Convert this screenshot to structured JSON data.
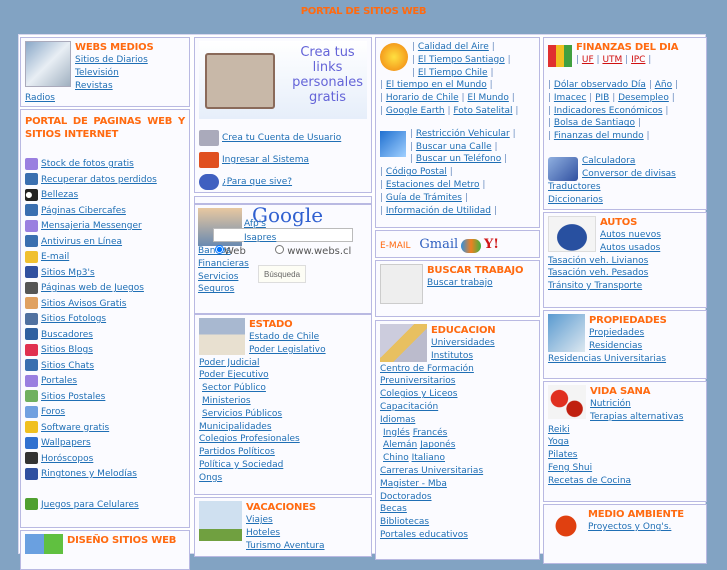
{
  "title": "PORTAL DE SITIOS WEB",
  "medios": {
    "heading": "WEBS MEDIOS",
    "links": [
      "Sitios de Diarios",
      "Televisión",
      "Revistas",
      "Radios"
    ]
  },
  "portal": {
    "heading": "PORTAL DE PAGINAS WEB Y SITIOS INTERNET",
    "links": [
      "Stock de fotos gratis",
      "Recuperar datos perdidos",
      "Bellezas",
      "Páginas Cibercafes",
      "Mensajeria Messenger",
      "Antivirus en Línea",
      "E-mail",
      "Sitios Mp3's",
      "Páginas web de Juegos",
      "Sitios Avisos Gratis",
      "Sitios Fotologs",
      "Buscadores",
      "Sitios Blogs",
      "Sitios Chats",
      "Portales",
      "Sitios Postales",
      "Foros",
      "Software gratis",
      "Wallpapers",
      "Horóscopos",
      "Ringtones y Melodías",
      "Juegos para Celulares"
    ],
    "icons": [
      "folder-icon",
      "monitor-icon",
      "eyes-icon",
      "monitor-icon",
      "folder-icon",
      "monitor-icon",
      "envelope-icon",
      "music-note-icon",
      "gamepad-icon",
      "pencil-icon",
      "photo-icon",
      "magnifier-icon",
      "checkmark-icon",
      "monitor-icon",
      "folder-icon",
      "postcard-icon",
      "speech-bubble-icon",
      "lightbulb-icon",
      "wallpaper-icon",
      "horoscope-icon",
      "music-note-icon",
      "cellphone-icon"
    ],
    "colors": [
      "#9a7fe0",
      "#3a6fb0",
      "#222",
      "#3a6fb0",
      "#9a7fe0",
      "#3a6fb0",
      "#f0c030",
      "#3050a0",
      "#555",
      "#e0a060",
      "#5070a0",
      "#3060a0",
      "#e03050",
      "#3a6fb0",
      "#9a7fe0",
      "#70b060",
      "#70a0e0",
      "#f0c020",
      "#3070d0",
      "#333",
      "#3050a0",
      "#50a030"
    ]
  },
  "diseno": {
    "heading": "DISEÑO SITIOS WEB"
  },
  "crea": {
    "banner": [
      "Crea tus",
      "links",
      "personales",
      "gratis"
    ],
    "links": [
      "Crea tu Cuenta de Usuario",
      "Ingresar al Sistema",
      "¿Para que sive?"
    ]
  },
  "google": {
    "logo": "Google",
    "links": [
      "Afp's",
      "Isapres",
      "Bancos",
      "Financieras",
      "Servicios",
      "Seguros"
    ],
    "radio_web": "Web",
    "radio_site": "www.webs.cl",
    "button": "Búsqueda",
    "input_value": ""
  },
  "estado": {
    "heading": "ESTADO",
    "links": [
      "Estado de Chile",
      "Poder Legislativo",
      "Poder Judicial",
      "Poder Ejecutivo",
      "Sector Público",
      "Ministerios",
      "Servicios Públicos",
      "Municipalidades",
      "Colegios Profesionales",
      "Partidos Políticos",
      "Política y Sociedad",
      "Ongs"
    ]
  },
  "vacaciones": {
    "heading": "VACACIONES",
    "links": [
      "Viajes",
      "Hoteles",
      "Turismo Aventura"
    ]
  },
  "utilidad": {
    "links": [
      "Calidad del Aire",
      "El Tiempo Santiago",
      "El Tiempo Chile",
      "El tiempo en el Mundo",
      "Horario de Chile",
      "El Mundo",
      "Google Earth",
      "Foto Satelital",
      "Restricción Vehicular",
      "Buscar una Calle",
      "Buscar un Teléfono",
      "Código Postal",
      "Estaciones del Metro",
      "Guía de Trámites",
      "Información de Utilidad"
    ]
  },
  "email": {
    "label": "E-MAIL",
    "gmail": "Gmail",
    "yahoo": "Y!"
  },
  "trabajo": {
    "heading": "BUSCAR TRABAJO",
    "links": [
      "Buscar trabajo"
    ]
  },
  "educacion": {
    "heading": "EDUCACION",
    "links": [
      "Universidades",
      "Institutos",
      "Centro de Formación",
      "Preuniversitarios",
      "Colegios y Liceos",
      "Capacitación",
      "Idiomas",
      "Inglés",
      "Francés",
      "Alemán",
      "Japonés",
      "Chino",
      "Italiano",
      "Carreras Universitarias",
      "Magister - Mba",
      "Doctorados",
      "Becas",
      "Bibliotecas",
      "Portales educativos"
    ]
  },
  "finanzas": {
    "heading": "FINANZAS DEL DIA",
    "top": [
      "UF",
      "UTM",
      "IPC"
    ],
    "links": [
      "Dólar observado Día",
      "Año",
      "Imacec",
      "PIB",
      "Desempleo",
      "Indicadores Económicos",
      "Bolsa de Santiago",
      "Finanzas del mundo",
      "Calculadora",
      "Conversor de divisas",
      "Traductores",
      "Diccionarios"
    ]
  },
  "autos": {
    "heading": "AUTOS",
    "links": [
      "Autos nuevos",
      "Autos usados",
      "Tasación veh. Livianos",
      "Tasación veh. Pesados",
      "Tránsito y Transporte"
    ]
  },
  "propiedades": {
    "heading": "PROPIEDADES",
    "links": [
      "Propiedades",
      "Residencias",
      "Residencias Universitarias"
    ]
  },
  "vida": {
    "heading": "VIDA SANA",
    "links": [
      "Nutrición",
      "Terapias alternativas",
      "Reiki",
      "Yoga",
      "Pilates",
      "Feng Shui",
      "Recetas de Cocina"
    ]
  },
  "medio": {
    "heading": "MEDIO AMBIENTE",
    "links": [
      "Proyectos y Ong's."
    ]
  }
}
